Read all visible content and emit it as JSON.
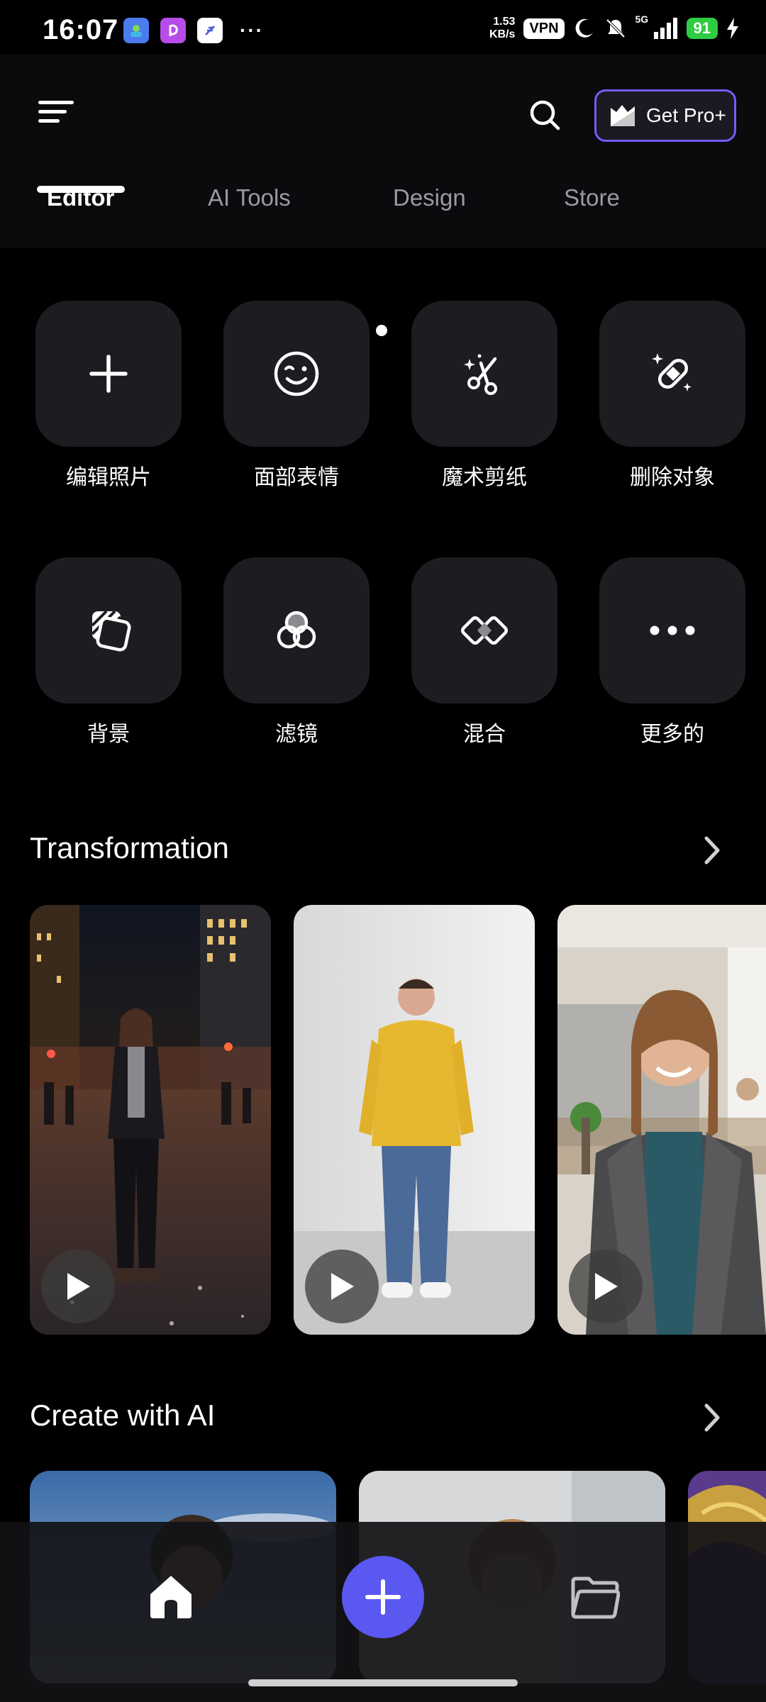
{
  "status_bar": {
    "time": "16:07",
    "net_speed_value": "1.53",
    "net_speed_unit": "KB/s",
    "vpn": "VPN",
    "signal": "5G",
    "battery": "91",
    "apps": [
      {
        "name": "gallery-app-icon",
        "color": "#4b7bec"
      },
      {
        "name": "picsart-app-icon",
        "color": "#b84ce8"
      },
      {
        "name": "feather-app-icon",
        "color": "#ffffff"
      }
    ],
    "more": "···"
  },
  "header": {
    "get_pro_label": "Get Pro+",
    "accent_color": "#7a5af8"
  },
  "tabs": [
    {
      "label": "Editor",
      "active": true
    },
    {
      "label": "AI Tools",
      "active": false
    },
    {
      "label": "Design",
      "active": false
    },
    {
      "label": "Store",
      "active": false
    }
  ],
  "tools": [
    {
      "label": "编辑照片",
      "icon": "plus-icon"
    },
    {
      "label": "面部表情",
      "icon": "face-wink-icon"
    },
    {
      "label": "魔术剪纸",
      "icon": "magic-scissors-icon"
    },
    {
      "label": "删除对象",
      "icon": "bandage-eraser-icon"
    },
    {
      "label": "背景",
      "icon": "background-layers-icon"
    },
    {
      "label": "滤镜",
      "icon": "filter-circles-icon"
    },
    {
      "label": "混合",
      "icon": "blend-diamond-icon"
    },
    {
      "label": "更多的",
      "icon": "more-dots-icon"
    }
  ],
  "sections": {
    "transformation": "Transformation",
    "create_with_ai": "Create with AI"
  },
  "nav": {
    "add_color": "#5a58f0"
  }
}
